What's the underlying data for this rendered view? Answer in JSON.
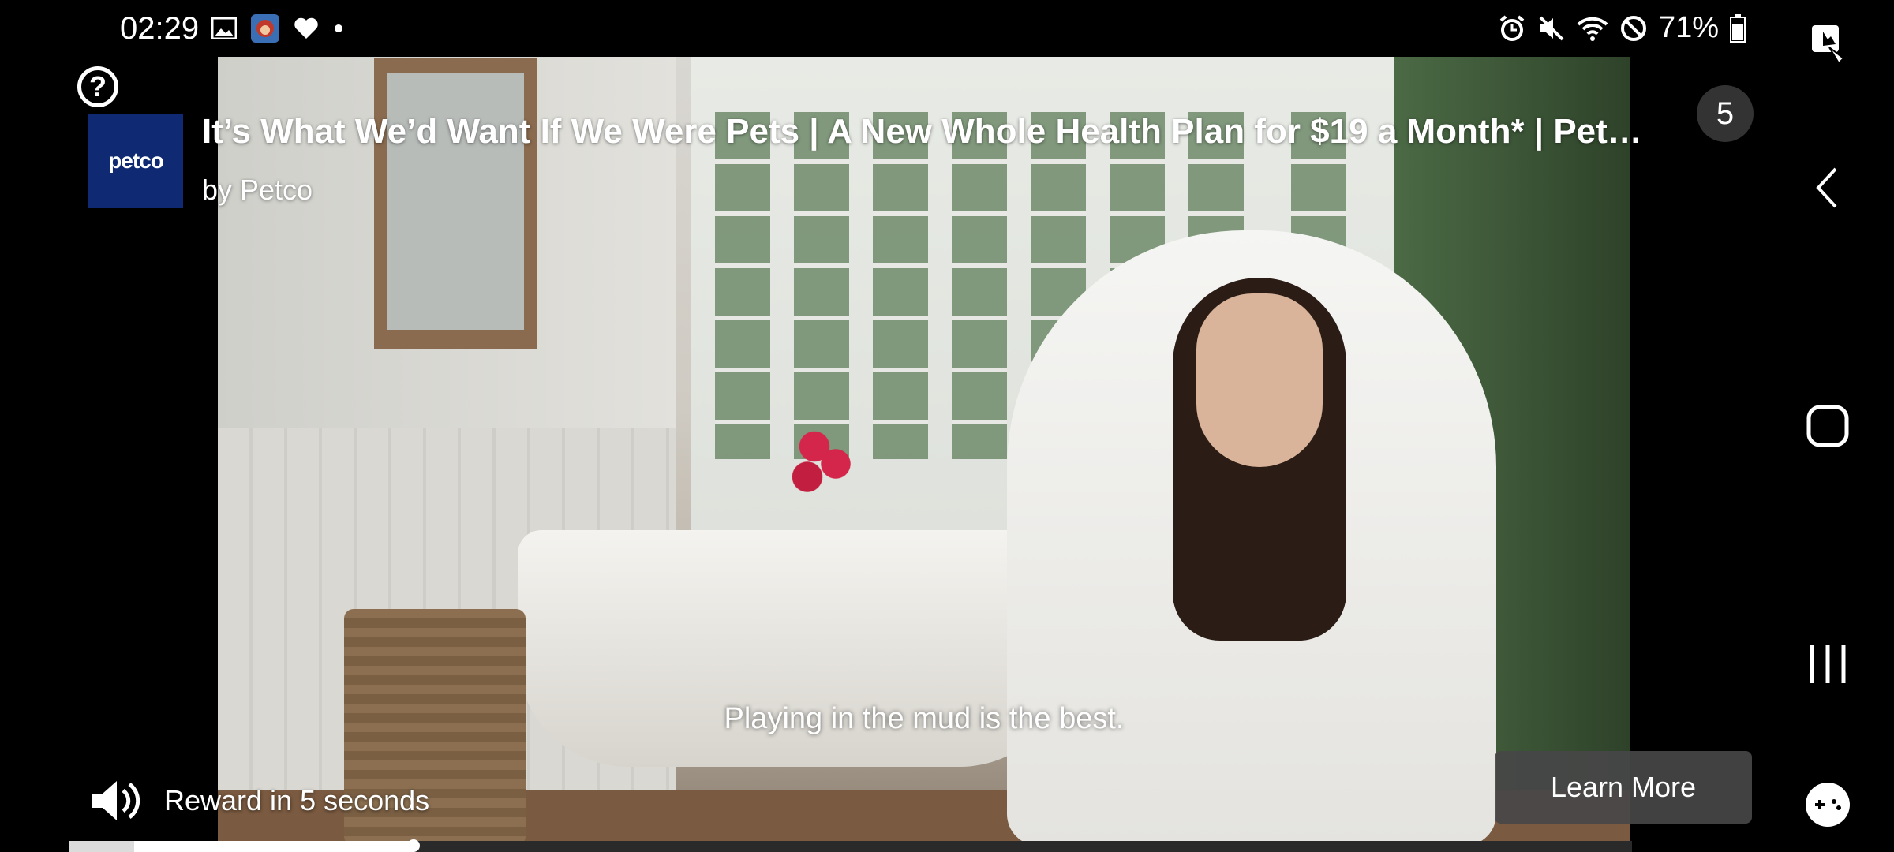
{
  "status_bar": {
    "time": "02:29",
    "left_icons": [
      "gallery-icon",
      "app-avatar-icon",
      "heart-icon",
      "dot-icon"
    ],
    "right_icons": [
      "alarm-icon",
      "mute-icon",
      "wifi-icon",
      "do-not-disturb-icon"
    ],
    "battery_percent": "71%"
  },
  "ad": {
    "brand_logo_text": "petco",
    "title": "It’s What We’d Want If We Were Pets | A New Whole Health Plan for $19 a Month* | Pet…",
    "by_line": "by Petco",
    "countdown": "5",
    "subtitle": "Playing in the mud is the best.",
    "reward_text": "Reward in 5 seconds",
    "learn_more_label": "Learn More"
  },
  "progress": {
    "fraction": 0.22
  },
  "nav_bar": {
    "items": [
      "screen-capture-icon",
      "back-icon",
      "home-icon",
      "recents-icon",
      "game-tools-icon"
    ]
  },
  "colors": {
    "brand": "#0f2a73",
    "button_bg": "#464648"
  }
}
